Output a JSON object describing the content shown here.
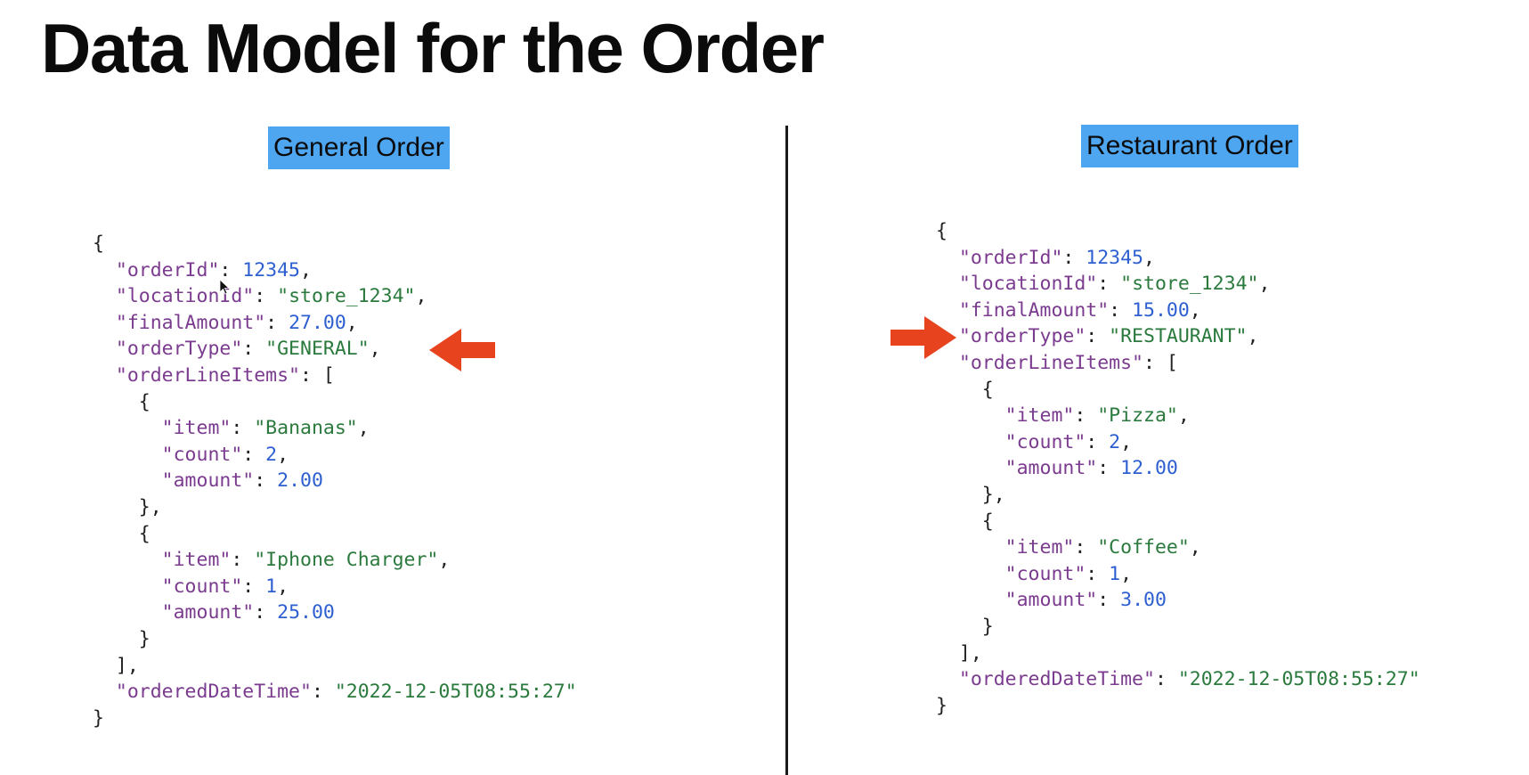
{
  "title": "Data Model for the Order",
  "panels": {
    "left": {
      "heading": "General Order",
      "lines": [
        [
          {
            "t": "{",
            "c": "punct"
          }
        ],
        [
          {
            "t": "  "
          },
          {
            "t": "\"orderId\"",
            "c": "key"
          },
          {
            "t": ": ",
            "c": "punct"
          },
          {
            "t": "12345",
            "c": "num"
          },
          {
            "t": ",",
            "c": "punct"
          }
        ],
        [
          {
            "t": "  "
          },
          {
            "t": "\"locationId\"",
            "c": "key"
          },
          {
            "t": ": ",
            "c": "punct"
          },
          {
            "t": "\"store_1234\"",
            "c": "str"
          },
          {
            "t": ",",
            "c": "punct"
          }
        ],
        [
          {
            "t": "  "
          },
          {
            "t": "\"finalAmount\"",
            "c": "key"
          },
          {
            "t": ": ",
            "c": "punct"
          },
          {
            "t": "27.00",
            "c": "num"
          },
          {
            "t": ",",
            "c": "punct"
          }
        ],
        [
          {
            "t": "  "
          },
          {
            "t": "\"orderType\"",
            "c": "key"
          },
          {
            "t": ": ",
            "c": "punct"
          },
          {
            "t": "\"GENERAL\"",
            "c": "str"
          },
          {
            "t": ",",
            "c": "punct"
          }
        ],
        [
          {
            "t": "  "
          },
          {
            "t": "\"orderLineItems\"",
            "c": "key"
          },
          {
            "t": ": [",
            "c": "punct"
          }
        ],
        [
          {
            "t": "    "
          },
          {
            "t": "{",
            "c": "punct"
          }
        ],
        [
          {
            "t": "      "
          },
          {
            "t": "\"item\"",
            "c": "key"
          },
          {
            "t": ": ",
            "c": "punct"
          },
          {
            "t": "\"Bananas\"",
            "c": "str"
          },
          {
            "t": ",",
            "c": "punct"
          }
        ],
        [
          {
            "t": "      "
          },
          {
            "t": "\"count\"",
            "c": "key"
          },
          {
            "t": ": ",
            "c": "punct"
          },
          {
            "t": "2",
            "c": "num"
          },
          {
            "t": ",",
            "c": "punct"
          }
        ],
        [
          {
            "t": "      "
          },
          {
            "t": "\"amount\"",
            "c": "key"
          },
          {
            "t": ": ",
            "c": "punct"
          },
          {
            "t": "2.00",
            "c": "num"
          }
        ],
        [
          {
            "t": "    "
          },
          {
            "t": "},",
            "c": "punct"
          }
        ],
        [
          {
            "t": "    "
          },
          {
            "t": "{",
            "c": "punct"
          }
        ],
        [
          {
            "t": "      "
          },
          {
            "t": "\"item\"",
            "c": "key"
          },
          {
            "t": ": ",
            "c": "punct"
          },
          {
            "t": "\"Iphone Charger\"",
            "c": "str"
          },
          {
            "t": ",",
            "c": "punct"
          }
        ],
        [
          {
            "t": "      "
          },
          {
            "t": "\"count\"",
            "c": "key"
          },
          {
            "t": ": ",
            "c": "punct"
          },
          {
            "t": "1",
            "c": "num"
          },
          {
            "t": ",",
            "c": "punct"
          }
        ],
        [
          {
            "t": "      "
          },
          {
            "t": "\"amount\"",
            "c": "key"
          },
          {
            "t": ": ",
            "c": "punct"
          },
          {
            "t": "25.00",
            "c": "num"
          }
        ],
        [
          {
            "t": "    "
          },
          {
            "t": "}",
            "c": "punct"
          }
        ],
        [
          {
            "t": "  "
          },
          {
            "t": "],",
            "c": "punct"
          }
        ],
        [
          {
            "t": "  "
          },
          {
            "t": "\"orderedDateTime\"",
            "c": "key"
          },
          {
            "t": ": ",
            "c": "punct"
          },
          {
            "t": "\"2022-12-05T08:55:27\"",
            "c": "str"
          }
        ],
        [
          {
            "t": "}",
            "c": "punct"
          }
        ]
      ]
    },
    "right": {
      "heading": "Restaurant Order",
      "lines": [
        [
          {
            "t": "{",
            "c": "punct"
          }
        ],
        [
          {
            "t": "  "
          },
          {
            "t": "\"orderId\"",
            "c": "key"
          },
          {
            "t": ": ",
            "c": "punct"
          },
          {
            "t": "12345",
            "c": "num"
          },
          {
            "t": ",",
            "c": "punct"
          }
        ],
        [
          {
            "t": "  "
          },
          {
            "t": "\"locationId\"",
            "c": "key"
          },
          {
            "t": ": ",
            "c": "punct"
          },
          {
            "t": "\"store_1234\"",
            "c": "str"
          },
          {
            "t": ",",
            "c": "punct"
          }
        ],
        [
          {
            "t": "  "
          },
          {
            "t": "\"finalAmount\"",
            "c": "key"
          },
          {
            "t": ": ",
            "c": "punct"
          },
          {
            "t": "15.00",
            "c": "num"
          },
          {
            "t": ",",
            "c": "punct"
          }
        ],
        [
          {
            "t": "  "
          },
          {
            "t": "\"orderType\"",
            "c": "key"
          },
          {
            "t": ": ",
            "c": "punct"
          },
          {
            "t": "\"RESTAURANT\"",
            "c": "str"
          },
          {
            "t": ",",
            "c": "punct"
          }
        ],
        [
          {
            "t": "  "
          },
          {
            "t": "\"orderLineItems\"",
            "c": "key"
          },
          {
            "t": ": [",
            "c": "punct"
          }
        ],
        [
          {
            "t": "    "
          },
          {
            "t": "{",
            "c": "punct"
          }
        ],
        [
          {
            "t": "      "
          },
          {
            "t": "\"item\"",
            "c": "key"
          },
          {
            "t": ": ",
            "c": "punct"
          },
          {
            "t": "\"Pizza\"",
            "c": "str"
          },
          {
            "t": ",",
            "c": "punct"
          }
        ],
        [
          {
            "t": "      "
          },
          {
            "t": "\"count\"",
            "c": "key"
          },
          {
            "t": ": ",
            "c": "punct"
          },
          {
            "t": "2",
            "c": "num"
          },
          {
            "t": ",",
            "c": "punct"
          }
        ],
        [
          {
            "t": "      "
          },
          {
            "t": "\"amount\"",
            "c": "key"
          },
          {
            "t": ": ",
            "c": "punct"
          },
          {
            "t": "12.00",
            "c": "num"
          }
        ],
        [
          {
            "t": "    "
          },
          {
            "t": "},",
            "c": "punct"
          }
        ],
        [
          {
            "t": "    "
          },
          {
            "t": "{",
            "c": "punct"
          }
        ],
        [
          {
            "t": "      "
          },
          {
            "t": "\"item\"",
            "c": "key"
          },
          {
            "t": ": ",
            "c": "punct"
          },
          {
            "t": "\"Coffee\"",
            "c": "str"
          },
          {
            "t": ",",
            "c": "punct"
          }
        ],
        [
          {
            "t": "      "
          },
          {
            "t": "\"count\"",
            "c": "key"
          },
          {
            "t": ": ",
            "c": "punct"
          },
          {
            "t": "1",
            "c": "num"
          },
          {
            "t": ",",
            "c": "punct"
          }
        ],
        [
          {
            "t": "      "
          },
          {
            "t": "\"amount\"",
            "c": "key"
          },
          {
            "t": ": ",
            "c": "punct"
          },
          {
            "t": "3.00",
            "c": "num"
          }
        ],
        [
          {
            "t": "    "
          },
          {
            "t": "}",
            "c": "punct"
          }
        ],
        [
          {
            "t": "  "
          },
          {
            "t": "],",
            "c": "punct"
          }
        ],
        [
          {
            "t": "  "
          },
          {
            "t": "\"orderedDateTime\"",
            "c": "key"
          },
          {
            "t": ": ",
            "c": "punct"
          },
          {
            "t": "\"2022-12-05T08:55:27\"",
            "c": "str"
          }
        ],
        [
          {
            "t": "}",
            "c": "punct"
          }
        ]
      ]
    }
  },
  "icons": {
    "left_arrow": "arrow-left-icon",
    "right_arrow": "arrow-right-icon",
    "cursor": "mouse-pointer-icon"
  },
  "colors": {
    "background": "#ffffff",
    "heading_bg": "#4ea6f0",
    "json_key": "#7b3b8f",
    "json_string": "#2b7a3d",
    "json_number": "#2e5fd1",
    "arrow": "#e8431f",
    "divider": "#1a1a1a"
  }
}
